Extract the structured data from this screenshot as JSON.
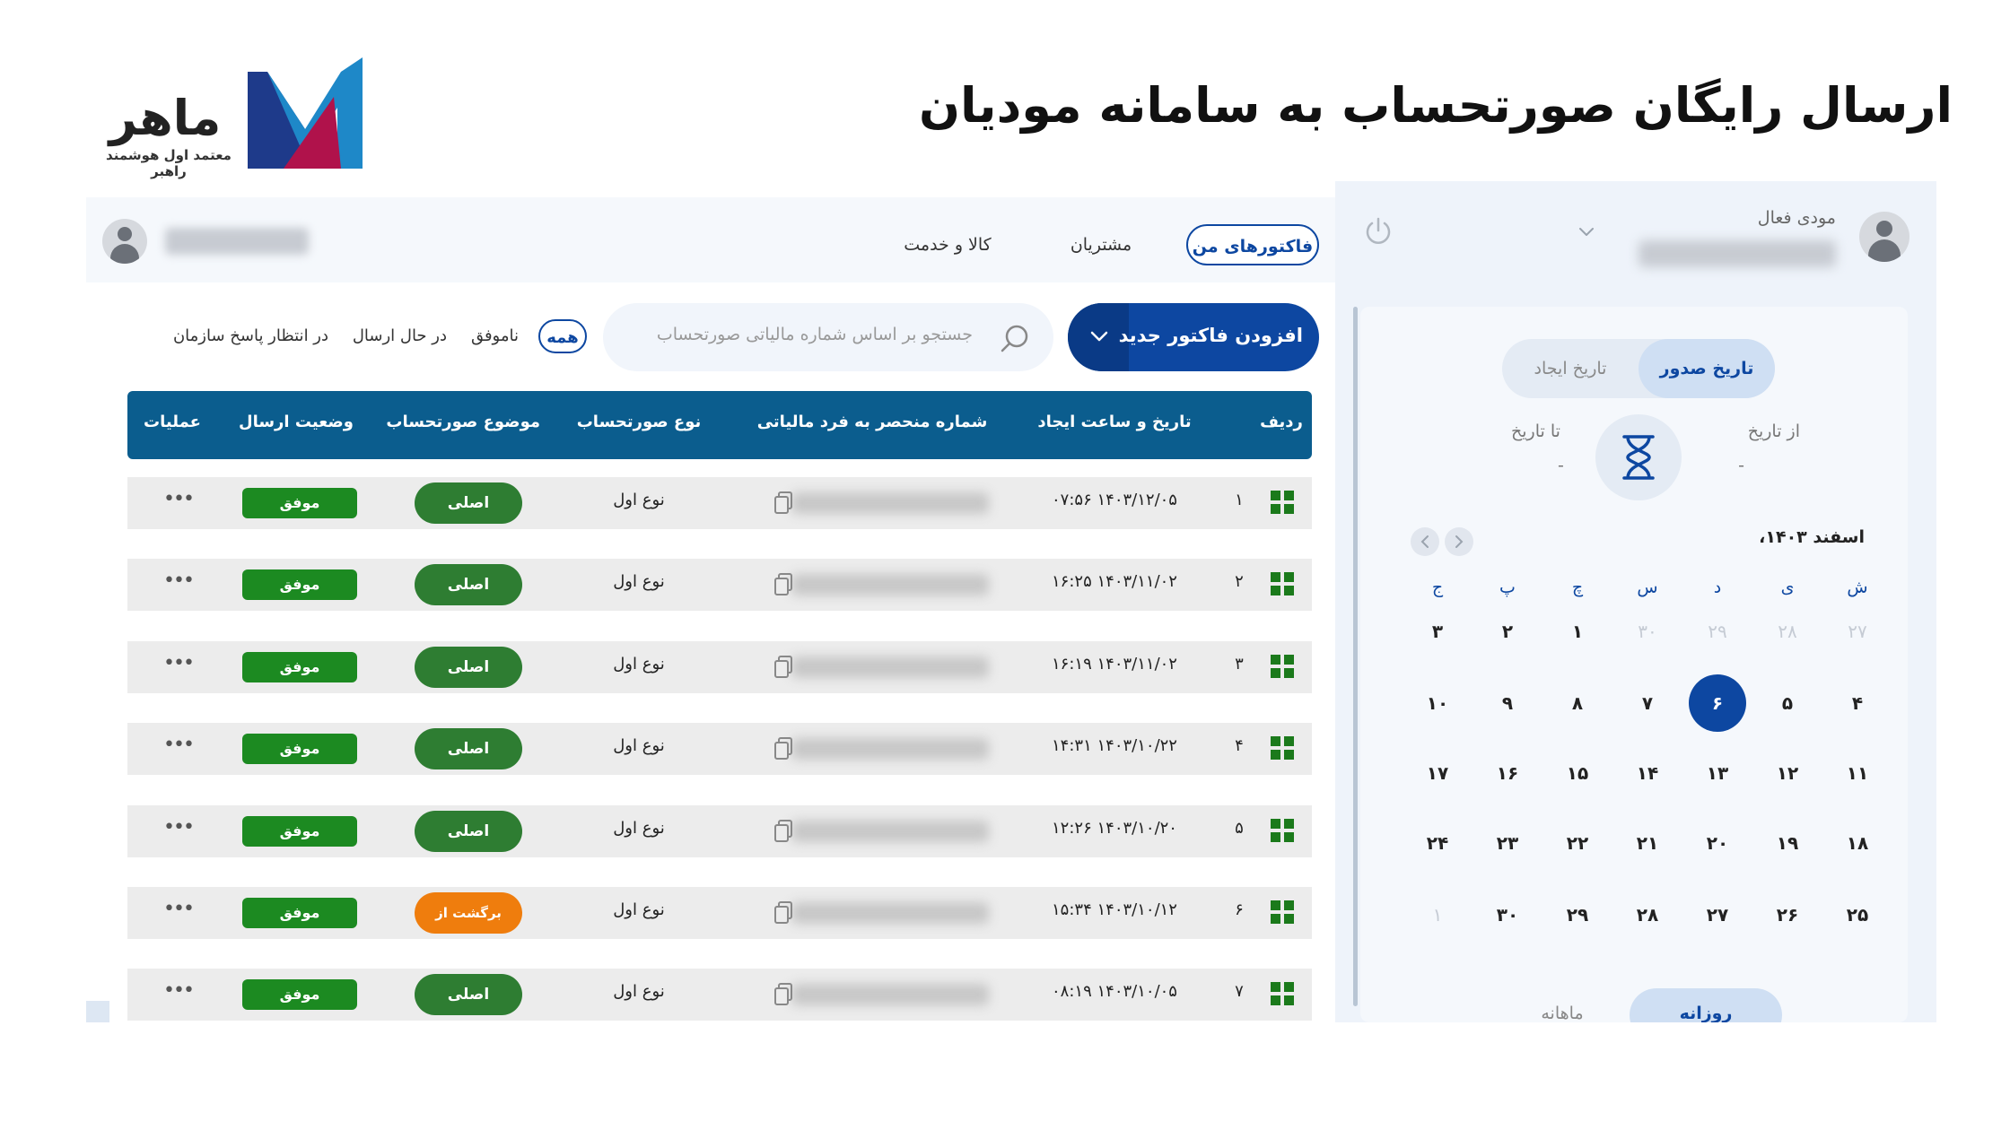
{
  "header": {
    "title": "ارسال رایگان صورتحساب به سامانه مودیان",
    "logo_name": "ماهر",
    "logo_tagline": "معتمد اول هوشمند راهبر"
  },
  "topnav": {
    "tabs": [
      {
        "label": "فاکتورهای من",
        "active": true
      },
      {
        "label": "مشتریان",
        "active": false
      },
      {
        "label": "کالا و خدمت",
        "active": false
      }
    ]
  },
  "toolbar": {
    "add_invoice_label": "افزودن فاکتور جدید",
    "search_placeholder": "جستجو بر اساس شماره مالیاتی صورتحساب",
    "filters": [
      {
        "label": "همه",
        "active": true
      },
      {
        "label": "ناموفق",
        "active": false
      },
      {
        "label": "در حال ارسال",
        "active": false
      },
      {
        "label": "در انتظار پاسخ سازمان",
        "active": false
      }
    ]
  },
  "table": {
    "columns": [
      "ردیف",
      "تاریخ و ساعت ایجاد",
      "شماره منحصر به فرد مالیاتی",
      "نوع صورتحساب",
      "موضوع صورتحساب",
      "وضعیت ارسال",
      "عملیات"
    ],
    "rows": [
      {
        "index": "۱",
        "created": "۱۴۰۳/۱۲/۰۵ ۰۷:۵۶",
        "type": "نوع اول",
        "subject": "اصلی",
        "subject_color": "#2e7d32",
        "status": "موفق"
      },
      {
        "index": "۲",
        "created": "۱۴۰۳/۱۱/۰۲ ۱۶:۲۵",
        "type": "نوع اول",
        "subject": "اصلی",
        "subject_color": "#2e7d32",
        "status": "موفق"
      },
      {
        "index": "۳",
        "created": "۱۴۰۳/۱۱/۰۲ ۱۶:۱۹",
        "type": "نوع اول",
        "subject": "اصلی",
        "subject_color": "#2e7d32",
        "status": "موفق"
      },
      {
        "index": "۴",
        "created": "۱۴۰۳/۱۰/۲۲ ۱۴:۳۱",
        "type": "نوع اول",
        "subject": "اصلی",
        "subject_color": "#2e7d32",
        "status": "موفق"
      },
      {
        "index": "۵",
        "created": "۱۴۰۳/۱۰/۲۰ ۱۲:۲۶",
        "type": "نوع اول",
        "subject": "اصلی",
        "subject_color": "#2e7d32",
        "status": "موفق"
      },
      {
        "index": "۶",
        "created": "۱۴۰۳/۱۰/۱۲ ۱۵:۳۴",
        "type": "نوع اول",
        "subject": "برگشت از فروش",
        "subject_color": "#ef7d0d",
        "status": "موفق"
      },
      {
        "index": "۷",
        "created": "۱۴۰۳/۱۰/۰۵ ۰۸:۱۹",
        "type": "نوع اول",
        "subject": "اصلی",
        "subject_color": "#2e7d32",
        "status": "موفق"
      }
    ],
    "more_label": "•••"
  },
  "side": {
    "user_label": "مودی فعال",
    "date_toggle": [
      {
        "label": "تاریخ صدور",
        "active": true
      },
      {
        "label": "تاریخ ایجاد",
        "active": false
      }
    ],
    "from_label": "از تاریخ",
    "to_label": "تا تاریخ",
    "from_value": "-",
    "to_value": "-",
    "month_title": "اسفند ۱۴۰۳،",
    "weekdays": [
      "ش",
      "ی",
      "د",
      "س",
      "چ",
      "پ",
      "ج"
    ],
    "weeks": [
      [
        {
          "d": "۲۷",
          "m": true
        },
        {
          "d": "۲۸",
          "m": true
        },
        {
          "d": "۲۹",
          "m": true
        },
        {
          "d": "۳۰",
          "m": true
        },
        {
          "d": "۱"
        },
        {
          "d": "۲"
        },
        {
          "d": "۳"
        }
      ],
      [
        {
          "d": "۴"
        },
        {
          "d": "۵"
        },
        {
          "d": "۶",
          "s": true
        },
        {
          "d": "۷"
        },
        {
          "d": "۸"
        },
        {
          "d": "۹"
        },
        {
          "d": "۱۰"
        }
      ],
      [
        {
          "d": "۱۱"
        },
        {
          "d": "۱۲"
        },
        {
          "d": "۱۳"
        },
        {
          "d": "۱۴"
        },
        {
          "d": "۱۵"
        },
        {
          "d": "۱۶"
        },
        {
          "d": "۱۷"
        }
      ],
      [
        {
          "d": "۱۸"
        },
        {
          "d": "۱۹"
        },
        {
          "d": "۲۰"
        },
        {
          "d": "۲۱"
        },
        {
          "d": "۲۲"
        },
        {
          "d": "۲۳"
        },
        {
          "d": "۲۴"
        }
      ],
      [
        {
          "d": "۲۵"
        },
        {
          "d": "۲۶"
        },
        {
          "d": "۲۷"
        },
        {
          "d": "۲۸"
        },
        {
          "d": "۲۹"
        },
        {
          "d": "۳۰"
        },
        {
          "d": "۱",
          "m": true
        }
      ]
    ],
    "view_toggle": [
      {
        "label": "روزانه",
        "active": true
      },
      {
        "label": "ماهانه",
        "active": false
      }
    ]
  },
  "colors": {
    "primary": "#0d47a1",
    "table_header": "#0b5d8e",
    "success": "#1c8a21",
    "warning": "#ef7d0d"
  },
  "icons": [
    "search-icon",
    "chevron-down-icon",
    "qr-icon",
    "copy-icon",
    "more-icon",
    "power-icon",
    "hourglass-icon",
    "user-avatar-icon",
    "chevron-left-icon",
    "chevron-right-icon"
  ]
}
